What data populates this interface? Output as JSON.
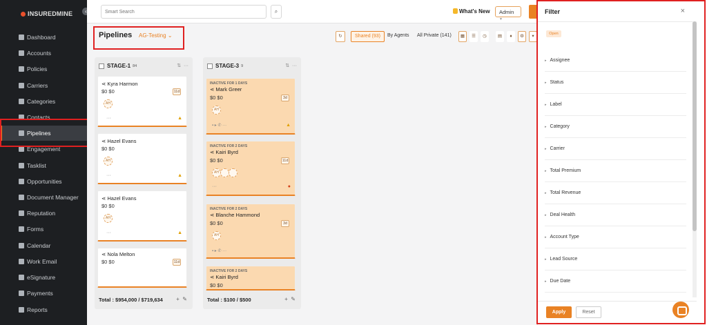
{
  "app": {
    "logo_bold": "INSUREDMINE",
    "logo_thin": ""
  },
  "sidebar": {
    "items": [
      {
        "label": "Dashboard"
      },
      {
        "label": "Accounts"
      },
      {
        "label": "Policies"
      },
      {
        "label": "Carriers"
      },
      {
        "label": "Categories"
      },
      {
        "label": "Contacts"
      },
      {
        "label": "Pipelines"
      },
      {
        "label": "Engagement"
      },
      {
        "label": "Tasklist"
      },
      {
        "label": "Opportunities"
      },
      {
        "label": "Document Manager"
      },
      {
        "label": "Reputation"
      },
      {
        "label": "Forms"
      },
      {
        "label": "Calendar"
      },
      {
        "label": "Work Email"
      },
      {
        "label": "eSignature"
      },
      {
        "label": "Payments"
      },
      {
        "label": "Reports"
      }
    ]
  },
  "topbar": {
    "search_placeholder": "Smart Search",
    "whats_new": "What's New",
    "admin": "Admin"
  },
  "pipeline": {
    "title": "Pipelines",
    "selected": "AG-Testing"
  },
  "toolbar": {
    "shared": "Shared (93)",
    "by_agents": "By Agents",
    "all_private": "All Private (141)"
  },
  "columns": [
    {
      "name": "STAGE-1",
      "count": "84",
      "total": "Total : $954,000 / $719,634",
      "cards": [
        {
          "name": "Kyra Harmon",
          "money": "$0  $0",
          "age": "11d",
          "avatar": "AH",
          "inactive": ""
        },
        {
          "name": "Hazel Evans",
          "money": "$0  $0",
          "age": "",
          "avatar": "AH",
          "inactive": ""
        },
        {
          "name": "Hazel Evans",
          "money": "$0  $0",
          "age": "",
          "avatar": "AH",
          "inactive": ""
        },
        {
          "name": "Nola Melton",
          "money": "$0  $0",
          "age": "11d",
          "avatar": "",
          "inactive": ""
        }
      ]
    },
    {
      "name": "STAGE-3",
      "count": "9",
      "total": "Total : $100 / $500",
      "cards": [
        {
          "name": "Mark Greer",
          "money": "$0  $0",
          "age": "3d",
          "avatar": "AH",
          "inactive": "INACTIVE FOR 1 DAYS"
        },
        {
          "name": "Kairi Byrd",
          "money": "$0  $0",
          "age": "11d",
          "avatar": "AH",
          "inactive": "INACTIVE FOR 2 DAYS"
        },
        {
          "name": "Blanche Hammond",
          "money": "$0  $0",
          "age": "3d",
          "avatar": "AH",
          "inactive": "INACTIVE FOR 2 DAYS"
        },
        {
          "name": "Kairi Byrd",
          "money": "$0  $0",
          "age": "",
          "avatar": "",
          "inactive": "INACTIVE FOR 2 DAYS"
        }
      ]
    }
  ],
  "filter": {
    "title": "Filter",
    "open_badge": "Open",
    "rows": [
      {
        "label": "Assignee"
      },
      {
        "label": "Status"
      },
      {
        "label": "Label"
      },
      {
        "label": "Category"
      },
      {
        "label": "Carrier"
      },
      {
        "label": "Total Premium"
      },
      {
        "label": "Total Revenue"
      },
      {
        "label": "Deal Health"
      },
      {
        "label": "Account Type"
      },
      {
        "label": "Lead Source"
      },
      {
        "label": "Due Date"
      }
    ],
    "apply": "Apply",
    "reset": "Reset"
  },
  "colors": {
    "accent": "#e98224",
    "highlight": "#e02020",
    "sidebar": "#1d1f22"
  }
}
